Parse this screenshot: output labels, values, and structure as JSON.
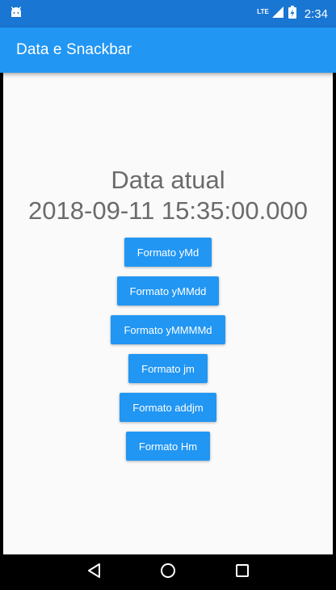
{
  "status_bar": {
    "network": "LTE",
    "time": "2:34",
    "icons": [
      "android-debug-icon",
      "signal-icon",
      "battery-charging-icon"
    ]
  },
  "app_bar": {
    "title": "Data e Snackbar",
    "color": "#2196F3"
  },
  "main": {
    "date_label": "Data atual",
    "date_value": "2018-09-11 15:35:00.000",
    "buttons": [
      {
        "label": "Formato yMd"
      },
      {
        "label": "Formato yMMdd"
      },
      {
        "label": "Formato yMMMMd"
      },
      {
        "label": "Formato jm"
      },
      {
        "label": "Formato addjm"
      },
      {
        "label": "Formato Hm"
      }
    ]
  },
  "nav_bar": {
    "icons": [
      "back-icon",
      "home-icon",
      "recents-icon"
    ]
  }
}
